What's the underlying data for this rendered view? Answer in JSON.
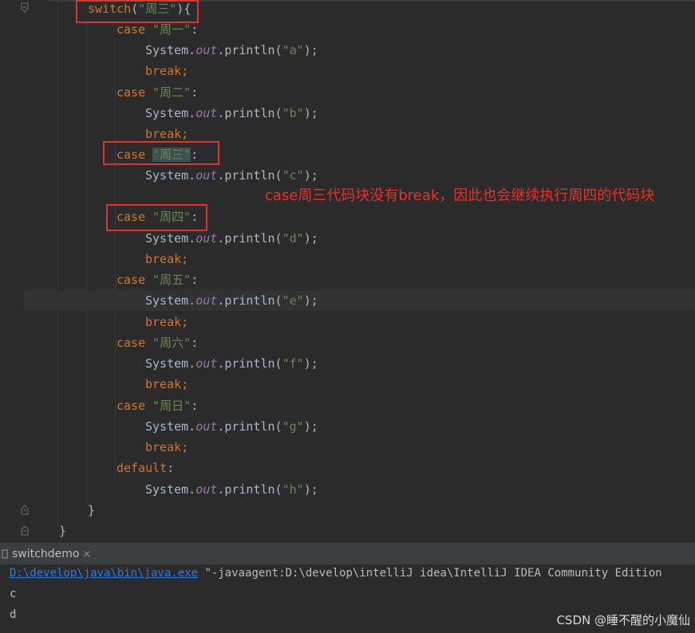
{
  "code": {
    "switch_kw": "switch",
    "switch_arg": "\"周三\"",
    "open": "){",
    "case_kw": "case",
    "break_stmt": "break;",
    "default_kw": "default",
    "sys": "System.",
    "out": "out",
    "println": ".println(",
    "close_call": ");",
    "colon": ":",
    "paren_open": "(",
    "cases": [
      {
        "label": "\"周一\"",
        "arg": "\"a\""
      },
      {
        "label": "\"周二\"",
        "arg": "\"b\""
      },
      {
        "label": "\"周三\"",
        "arg": "\"c\""
      },
      {
        "label": "\"周四\"",
        "arg": "\"d\""
      },
      {
        "label": "\"周五\"",
        "arg": "\"e\""
      },
      {
        "label": "\"周六\"",
        "arg": "\"f\""
      },
      {
        "label": "\"周日\"",
        "arg": "\"g\""
      }
    ],
    "default_arg": "\"h\"",
    "brace_close": "}"
  },
  "annotation": {
    "text": "case周三代码块没有break，因此也会继续执行周四的代码块"
  },
  "run_panel": {
    "tab_label": "switchdemo",
    "close_symbol": "×",
    "java_path": "D:\\develop\\java\\bin\\java.exe",
    "args": " \"-javaagent:D:\\develop\\intelliJ idea\\IntelliJ IDEA Community Edition",
    "output": [
      "c",
      "d"
    ]
  },
  "watermark": "CSDN @睡不醒的小魔仙",
  "colors": {
    "editor_bg": "#2b2b2b",
    "keyword": "#cc7832",
    "string": "#6a8759",
    "field": "#9876aa",
    "annotation_red": "#e8312a",
    "link": "#287bde"
  }
}
